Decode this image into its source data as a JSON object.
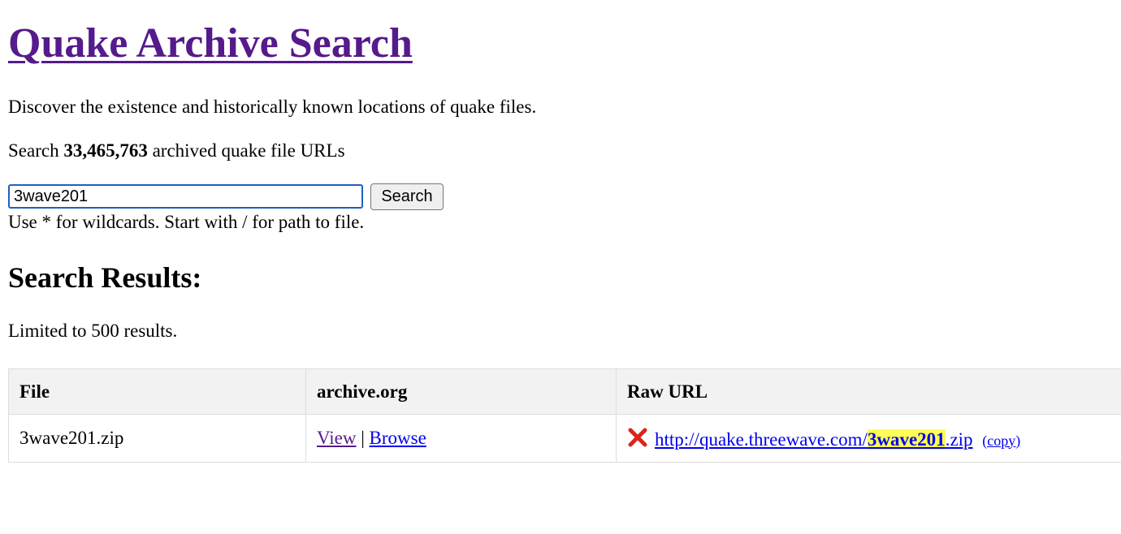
{
  "header": {
    "title": "Quake Archive Search",
    "tagline": "Discover the existence and historically known locations of quake files.",
    "count_prefix": "Search",
    "count_value": "33,465,763",
    "count_suffix": "archived quake file URLs"
  },
  "search": {
    "value": "3wave201",
    "button_label": "Search",
    "hint": "Use * for wildcards. Start with / for path to file."
  },
  "results": {
    "heading": "Search Results:",
    "limit_note": "Limited to 500 results.",
    "columns": [
      "File",
      "archive.org",
      "Raw URL"
    ],
    "rows": [
      {
        "file": "3wave201.zip",
        "view_label": "View",
        "separator": "|",
        "browse_label": "Browse",
        "status_icon": "red-x-icon",
        "url_prefix": "http://quake.threewave.com/",
        "url_match": "3wave201",
        "url_suffix": ".zip",
        "copy_label": "(copy)"
      }
    ]
  },
  "colors": {
    "visited_link": "#551a8b",
    "link": "#0000ee",
    "highlight": "#ffff54",
    "error_x": "#d9261c",
    "table_header_bg": "#f2f2f2"
  }
}
